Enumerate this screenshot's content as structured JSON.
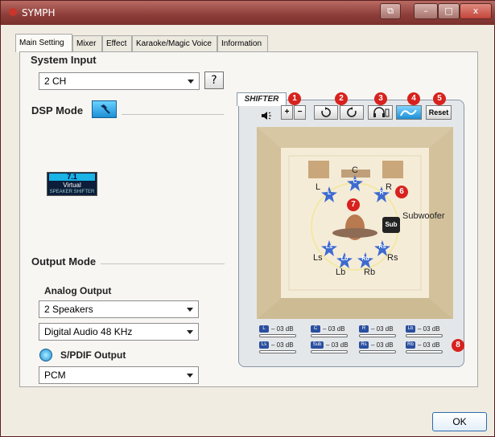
{
  "window": {
    "title": "SYMPH",
    "buttons": {
      "restore": "⧉",
      "minimize": "–",
      "maximize": "□",
      "close": "x"
    }
  },
  "tabs": [
    {
      "label": "Main Setting",
      "active": true
    },
    {
      "label": "Mixer"
    },
    {
      "label": "Effect"
    },
    {
      "label": "Karaoke/Magic Voice"
    },
    {
      "label": "Information"
    }
  ],
  "system_input": {
    "heading": "System Input",
    "value": "2 CH",
    "help_label": "?"
  },
  "dsp_mode": {
    "heading": "DSP Mode",
    "virtual_badge": {
      "top": "7.1",
      "mid": "Virtual",
      "bottom": "SPEAKER SHIFTER"
    }
  },
  "output_mode": {
    "heading": "Output Mode",
    "analog_heading": "Analog Output",
    "speakers_value": "2 Speakers",
    "digital_value": "Digital Audio 48 KHz",
    "spdif_label": "S/PDIF Output",
    "spdif_value": "PCM"
  },
  "shifter": {
    "tab_label": "SHIFTER",
    "reset_label": "Reset",
    "badges": [
      "1",
      "2",
      "3",
      "4",
      "5",
      "6",
      "7",
      "8"
    ],
    "speaker_labels": {
      "L": "L",
      "C": "C",
      "R": "R",
      "Sub": "Subwoofer",
      "Ls": "Ls",
      "Rs": "Rs",
      "Lb": "Lb",
      "Rb": "Rb"
    },
    "speaker_codes": {
      "L": "L",
      "C": "C",
      "R": "R",
      "Sub": "Sub",
      "Ls": "Ls",
      "Rs": "Rs",
      "Lb": "Lb",
      "Rb": "Rb"
    },
    "levels": [
      {
        "ch": "L",
        "text": "– 03 dB"
      },
      {
        "ch": "C",
        "text": "– 03 dB"
      },
      {
        "ch": "R",
        "text": "– 03 dB"
      },
      {
        "ch": "Lb",
        "text": "– 03 dB"
      },
      {
        "ch": "Ls",
        "text": "– 03 dB"
      },
      {
        "ch": "Sub",
        "text": "– 03 dB"
      },
      {
        "ch": "Rs",
        "text": "– 03 dB"
      },
      {
        "ch": "Rb",
        "text": "– 03 dB"
      }
    ]
  },
  "ok_label": "OK",
  "colors": {
    "title_bar": "#8d3d39",
    "accent_blue": "#1c8fd6",
    "badge_red": "#d7221e",
    "speaker_blue": "#3e6bd0"
  }
}
